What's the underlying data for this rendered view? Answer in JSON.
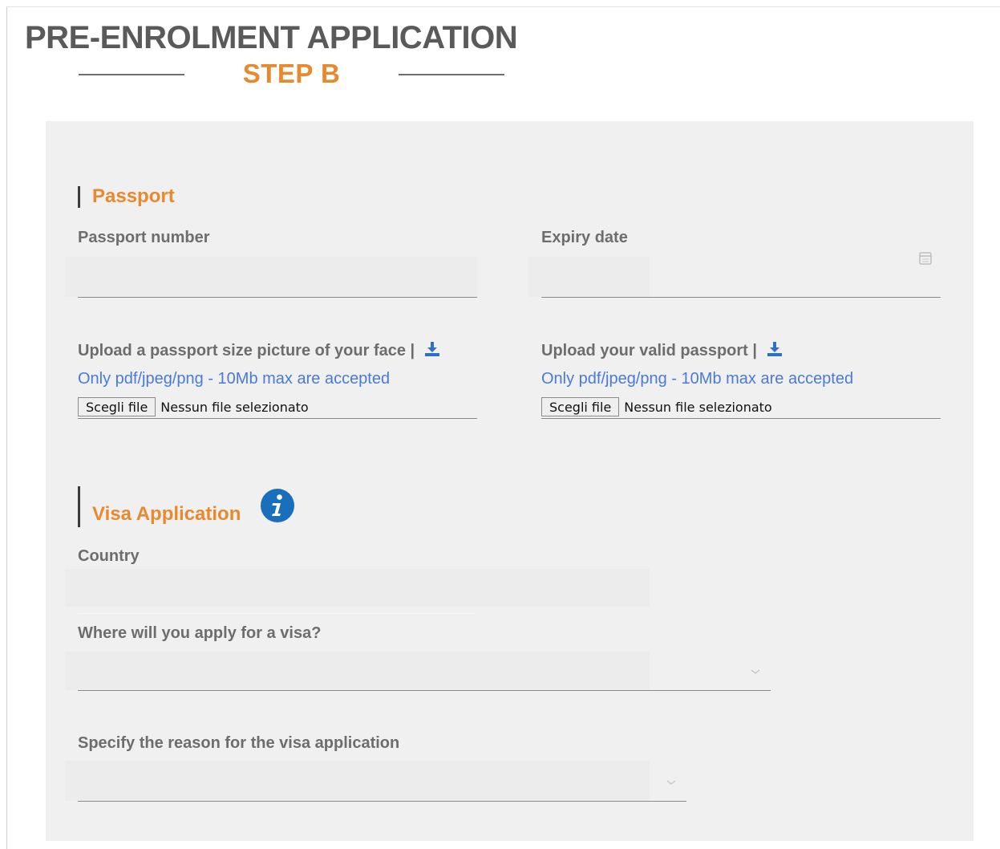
{
  "header": {
    "title": "PRE-ENROLMENT APPLICATION",
    "step": "STEP B"
  },
  "passport": {
    "section_title": "Passport",
    "number_label": "Passport number",
    "number_value": "",
    "expiry_label": "Expiry date",
    "expiry_value": "",
    "photo_upload_label": "Upload a passport size picture of your face |",
    "photo_upload_hint": "Only pdf/jpeg/png - 10Mb max are accepted",
    "passport_upload_label": "Upload your valid passport |",
    "passport_upload_hint": "Only pdf/jpeg/png - 10Mb max are accepted",
    "file_button_label": "Scegli file",
    "file_status": "Nessun file selezionato"
  },
  "visa": {
    "section_title": "Visa Application",
    "country_label": "Country",
    "country_value": "",
    "apply_where_label": "Where will you apply for a visa?",
    "apply_where_value": "",
    "reason_label": "Specify the reason for the visa application",
    "reason_value": ""
  },
  "icons": {
    "download": "download-icon",
    "info": "info-icon",
    "calendar": "calendar-icon",
    "dropdown": "chevron-down-icon"
  },
  "colors": {
    "accent": "#e8892e",
    "title": "#5a5a5a",
    "label": "#6d6d6d",
    "hint": "#4a7ad9",
    "info_icon": "#1a6fbd",
    "panel_bg": "#f0f0f0"
  }
}
